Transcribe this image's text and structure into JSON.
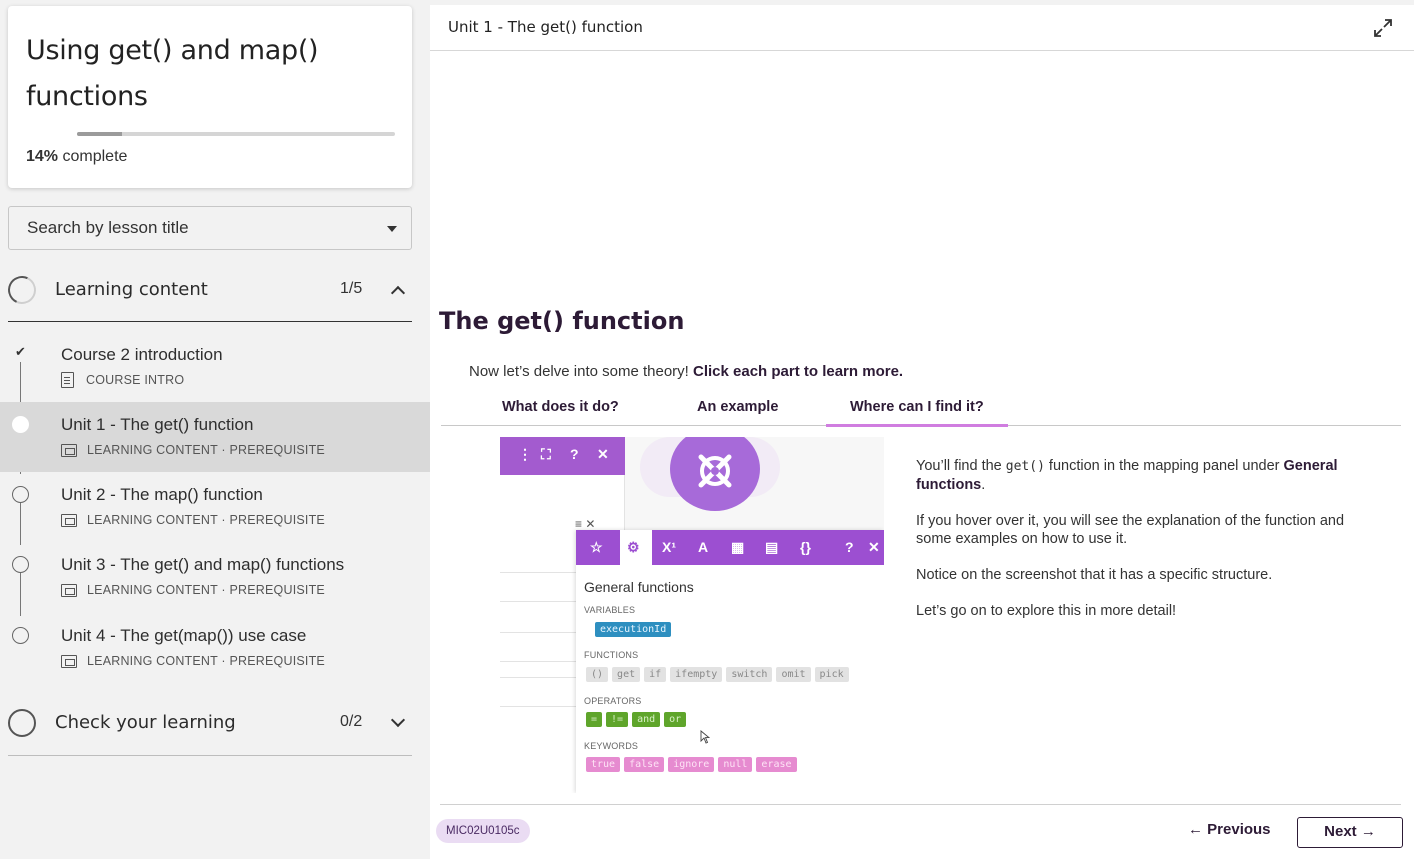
{
  "course": {
    "title": "Using get() and map() functions",
    "progress_value": "14%",
    "progress_suffix": "complete",
    "progress_fraction": 0.14
  },
  "search": {
    "label": "Search by lesson title"
  },
  "sections": [
    {
      "title": "Learning content",
      "count": "1/5",
      "expanded": true
    },
    {
      "title": "Check your learning",
      "count": "0/2",
      "expanded": false
    }
  ],
  "lessons": [
    {
      "name": "Course 2 introduction",
      "meta": "COURSE INTRO",
      "icon": "document-icon",
      "status": "completed"
    },
    {
      "name": "Unit 1 - The get() function",
      "meta": "LEARNING CONTENT · PREREQUISITE",
      "icon": "slide-icon",
      "status": "current"
    },
    {
      "name": "Unit 2 - The map() function",
      "meta": "LEARNING CONTENT · PREREQUISITE",
      "icon": "slide-icon",
      "status": "not-started"
    },
    {
      "name": "Unit 3 - The get() and map() functions",
      "meta": "LEARNING CONTENT · PREREQUISITE",
      "icon": "slide-icon",
      "status": "not-started"
    },
    {
      "name": "Unit 4 - The get(map()) use case",
      "meta": "LEARNING CONTENT · PREREQUISITE",
      "icon": "slide-icon",
      "status": "not-started"
    }
  ],
  "main": {
    "unit_title": "Unit 1 - The get() function",
    "lesson_title": "The get() function",
    "intro_plain": "Now let’s delve into some theory! ",
    "intro_strong": "Click each part to learn more.",
    "tabs": [
      "What does it do?",
      "An example",
      "Where can I find it?"
    ],
    "active_tab": 2,
    "explain": {
      "p1_a": "You’ll find the ",
      "p1_code": "get()",
      "p1_b": " function in the mapping panel under ",
      "p1_strong": "General functions",
      "p1_c": ".",
      "p2": "If you hover over it, you will see the explanation of the function and some examples on how to use it.",
      "p3": "Notice on the screenshot that it has a specific structure.",
      "p4": "Let’s go on to explore this in more detail!"
    },
    "screenshot": {
      "strip_icons": [
        "⋮",
        "⛶",
        "?",
        "✕"
      ],
      "mini_icons": [
        "≡",
        "✕"
      ],
      "toolbar_icons": [
        "☆",
        "⚙",
        "X¹",
        "A",
        "▦",
        "▤",
        "{}",
        "?",
        "✕"
      ],
      "panel_title": "General functions",
      "variables_label": "VARIABLES",
      "variables": [
        "executionId"
      ],
      "functions_label": "FUNCTIONS",
      "functions": [
        "()",
        "get",
        "if",
        "ifempty",
        "switch",
        "omit",
        "pick"
      ],
      "operators_label": "OPERATORS",
      "operators": [
        "=",
        "!=",
        "and",
        "or"
      ],
      "keywords_label": "KEYWORDS",
      "keywords": [
        "true",
        "false",
        "ignore",
        "null",
        "erase"
      ]
    },
    "footer": {
      "code": "MIC02U0105c",
      "previous": "← Previous",
      "next": "Next →"
    }
  },
  "colors": {
    "accent": "#d07de0",
    "brand_dark": "#2d1b36",
    "badge_bg": "#eadcf3",
    "make_purple": "#9c4fd1"
  }
}
